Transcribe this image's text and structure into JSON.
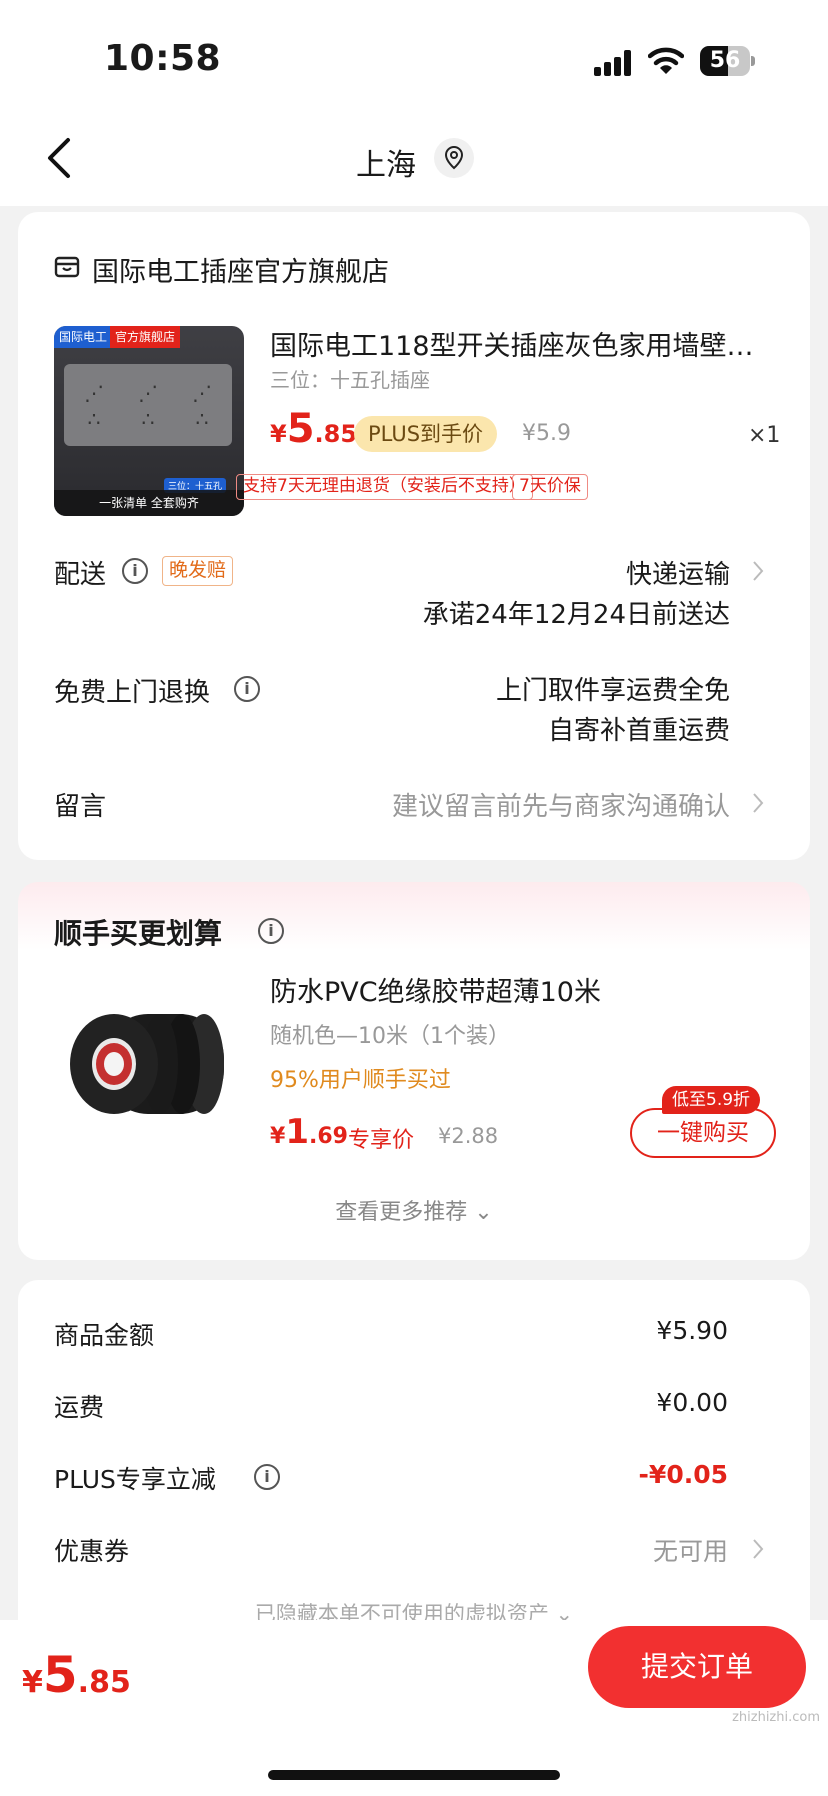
{
  "status": {
    "time": "10:58",
    "battery": "56"
  },
  "nav": {
    "title": "上海"
  },
  "order": {
    "shop_name": "国际电工插座官方旗舰店",
    "product": {
      "title": "国际电工118型开关插座灰色家用墙壁…",
      "spec": "三位：十五孔插座",
      "price_symbol": "¥",
      "price_int": "5",
      "price_dec": ".85",
      "plus_tag": "PLUS到手价",
      "original_price": "¥5.9",
      "qty": "×1",
      "badge_return": "支持7天无理由退货（安装后不支持）",
      "badge_protect": "7天价保",
      "image_tags": {
        "brand": "国际电工",
        "official": "官方旗舰店",
        "small": "三位：十五孔",
        "bottom": "一张清单 全套购齐"
      }
    },
    "delivery": {
      "label": "配送",
      "late_badge": "晚发赔",
      "method": "快递运输",
      "promise": "承诺24年12月24日前送达"
    },
    "free_return": {
      "label": "免费上门退换",
      "line1": "上门取件享运费全免",
      "line2": "自寄补首重运费"
    },
    "message": {
      "label": "留言",
      "placeholder": "建议留言前先与商家沟通确认"
    }
  },
  "addon": {
    "title": "顺手买更划算",
    "name": "防水PVC绝缘胶带超薄10米",
    "spec": "随机色—10米（1个装）",
    "hot": "95%用户顺手买过",
    "price_symbol": "¥",
    "price_int": "1",
    "price_dec": ".69",
    "exclusive": "专享价",
    "original_price": "¥2.88",
    "discount_tag": "低至5.9折",
    "buy_label": "一键购买",
    "more": "查看更多推荐 ⌄"
  },
  "summary": {
    "goods_label": "商品金额",
    "goods_value": "¥5.90",
    "shipping_label": "运费",
    "shipping_value": "¥0.00",
    "plus_label": "PLUS专享立减",
    "plus_value": "-¥0.05",
    "coupon_label": "优惠券",
    "coupon_value": "无可用",
    "hidden_assets": "已隐藏本单不可使用的虚拟资产 ⌄"
  },
  "footer": {
    "total_symbol": "¥",
    "total_int": "5",
    "total_dec": ".85",
    "submit": "提交订单",
    "watermark": "zhizhizhi.com"
  },
  "colors": {
    "accent": "#e2231a",
    "plus": "#fbe6ad",
    "bg": "#f2f2f2"
  }
}
